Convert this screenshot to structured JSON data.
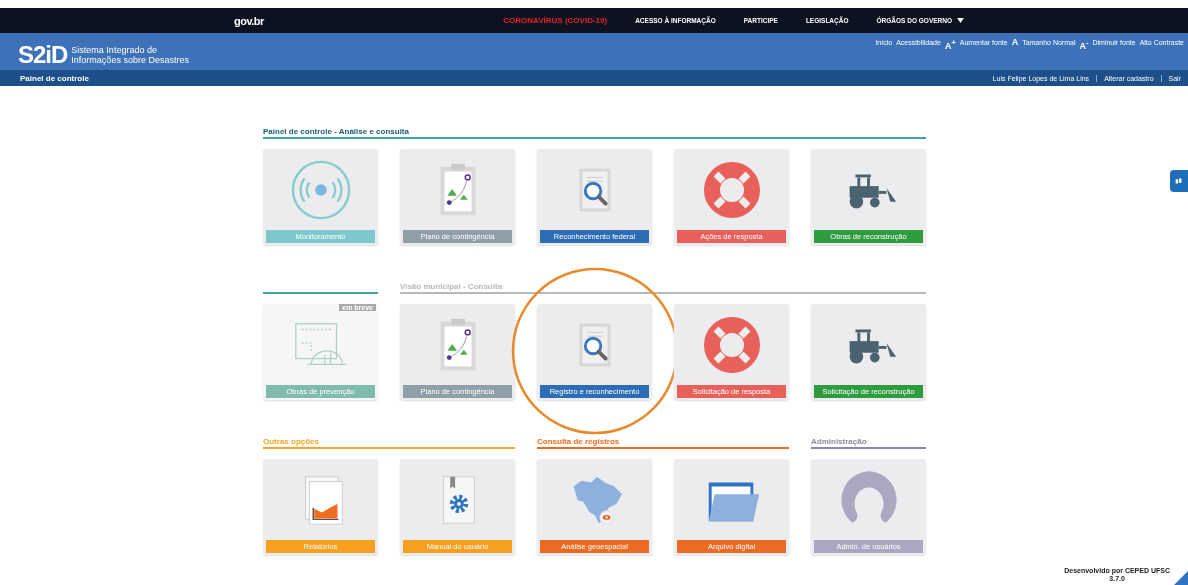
{
  "govbar": {
    "logo": "gov.br",
    "links": [
      {
        "label": "CORONAVÍRUS (COVID-19)",
        "kind": "alert"
      },
      {
        "label": "ACESSO À INFORMAÇÃO",
        "kind": "plain"
      },
      {
        "label": "PARTICIPE",
        "kind": "plain"
      },
      {
        "label": "LEGISLAÇÃO",
        "kind": "plain"
      },
      {
        "label": "ÓRGÃOS DO GOVERNO",
        "kind": "dropdown"
      }
    ]
  },
  "header": {
    "logo": "S2iD",
    "subtitle_lines": [
      "Sistema Integrado de",
      "Informações sobre Desastres"
    ],
    "accessibility": [
      {
        "label": "Início"
      },
      {
        "label": "Acessibilidade"
      },
      {
        "glyph": "A$^{+}$",
        "label": "Aumentar fonte"
      },
      {
        "glyph": "A",
        "label": "Tamanho Normal"
      },
      {
        "glyph": "A$^{-}$",
        "label": "Diminuir fonte"
      },
      {
        "label": "Alto Contraste"
      }
    ]
  },
  "navbar": {
    "title": "Painel de controle",
    "user_links": [
      "Luis Felipe Lopes de Lima Lins",
      "Alterar cadastro",
      "Sair"
    ]
  },
  "rows": [
    {
      "groups": [
        {
          "title": "Painel de controle - Análise e consulta",
          "color": "#3aa8a0",
          "tiles": [
            {
              "label": "Monitoramento",
              "kind": "signal",
              "color": "#7cc8cc",
              "disabled": false,
              "circled": false
            },
            {
              "label": "Plano de contingência",
              "kind": "plan",
              "color": "#8f9fa8",
              "disabled": false,
              "circled": false
            },
            {
              "label": "Reconhecimento federal",
              "kind": "search",
              "color": "#2d6db5",
              "disabled": false,
              "circled": false
            },
            {
              "label": "Ações de resposta",
              "kind": "lifebuoy",
              "color": "#e8605a",
              "disabled": false,
              "circled": false
            },
            {
              "label": "Obras de reconstrução",
              "kind": "bulldozer",
              "color": "#2e9b3e",
              "disabled": false,
              "circled": false
            }
          ]
        }
      ]
    },
    {
      "groups": [
        {
          "color": "#3aa8a0",
          "tiles": [
            {
              "label": "Obras de prevenção",
              "kind": "helmet",
              "color": "#7fbcae",
              "disabled": true,
              "circled": false,
              "badge": "em breve"
            }
          ]
        },
        {
          "title": "Visão municipal - Consulta",
          "color": "#b8b8b8",
          "tiles": [
            {
              "label": "Plano de contingência",
              "kind": "plan",
              "color": "#8f9fa8",
              "disabled": false,
              "circled": false
            },
            {
              "label": "Registro e reconhecimento",
              "kind": "search",
              "color": "#2d6db5",
              "disabled": false,
              "circled": true
            },
            {
              "label": "Solicitação de resposta",
              "kind": "lifebuoy",
              "color": "#e8605a",
              "disabled": false,
              "circled": false
            },
            {
              "label": "Solicitação de reconstrução",
              "kind": "bulldozer",
              "color": "#2e9b3e",
              "disabled": false,
              "circled": false
            }
          ]
        }
      ]
    },
    {
      "groups": [
        {
          "title": "Outras opções",
          "color": "#f5a623",
          "tiles": [
            {
              "label": "Relatórios",
              "kind": "chart",
              "color": "#f5a020",
              "disabled": false,
              "circled": false
            },
            {
              "label": "Manual do usuário",
              "kind": "manual",
              "color": "#f5a020",
              "disabled": false,
              "circled": false
            }
          ]
        },
        {
          "title": "Consulta de registros",
          "color": "#ec6b22",
          "tiles": [
            {
              "label": "Análise geoespacial",
              "kind": "map",
              "color": "#ec6b22",
              "disabled": false,
              "circled": false
            },
            {
              "label": "Arquivo digital",
              "kind": "folder",
              "color": "#ec6b22",
              "disabled": false,
              "circled": false
            }
          ]
        },
        {
          "title": "Administração",
          "color": "#8a89aa",
          "tiles": [
            {
              "label": "Admin. de usuários",
              "kind": "user",
              "color": "#a9a8c0",
              "disabled": false,
              "circled": false
            }
          ]
        }
      ]
    }
  ],
  "footer": {
    "lines": [
      "Desenvolvido por CEPED UFSC",
      "3.7.0"
    ]
  }
}
